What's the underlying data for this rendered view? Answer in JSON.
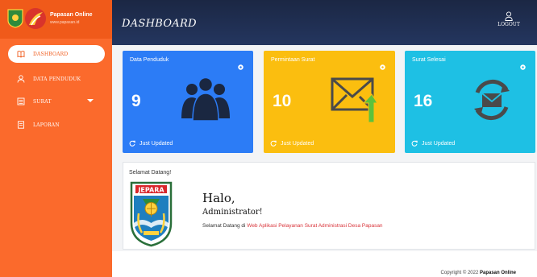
{
  "brand": {
    "title": "Papasan Online",
    "subtitle": "www.papasan.id",
    "colors": {
      "sidebar": "#fb6a2c",
      "brand_bar": "#f05a1a",
      "header": "#1b2744"
    }
  },
  "sidebar": {
    "items": [
      {
        "label": "Dashboard",
        "icon": "book-open-icon",
        "active": true
      },
      {
        "label": "Data Penduduk",
        "icon": "user-icon"
      },
      {
        "label": "Surat",
        "icon": "list-icon",
        "has_submenu": true
      },
      {
        "label": "Laporan",
        "icon": "document-icon"
      }
    ]
  },
  "header": {
    "title": "DASHBOARD",
    "logout_label": "Logout",
    "logout_icon": "user-icon"
  },
  "cards": [
    {
      "title": "Data Penduduk",
      "value": "9",
      "footer": "Just Updated",
      "color": "#2c7cf6",
      "icon": "users-icon"
    },
    {
      "title": "Permintaan Surat",
      "value": "10",
      "footer": "Just Updated",
      "color": "#fbbe0f",
      "icon": "envelope-upload-icon"
    },
    {
      "title": "Surat Selesai",
      "value": "16",
      "footer": "Just Updated",
      "color": "#1ec0e4",
      "icon": "envelope-sync-icon"
    }
  ],
  "welcome": {
    "heading": "Selamat Datang!",
    "crest_text": "JEPARA",
    "greeting": "Halo,",
    "user": "Administrator!",
    "message_prefix": "Selamat Datang di ",
    "message_link": "Web Aplikasi Pelayanan Surat Administrasi Desa Papasan"
  },
  "footer": {
    "prefix": "Copyright © 2022 ",
    "brand": "Papasan Online"
  }
}
